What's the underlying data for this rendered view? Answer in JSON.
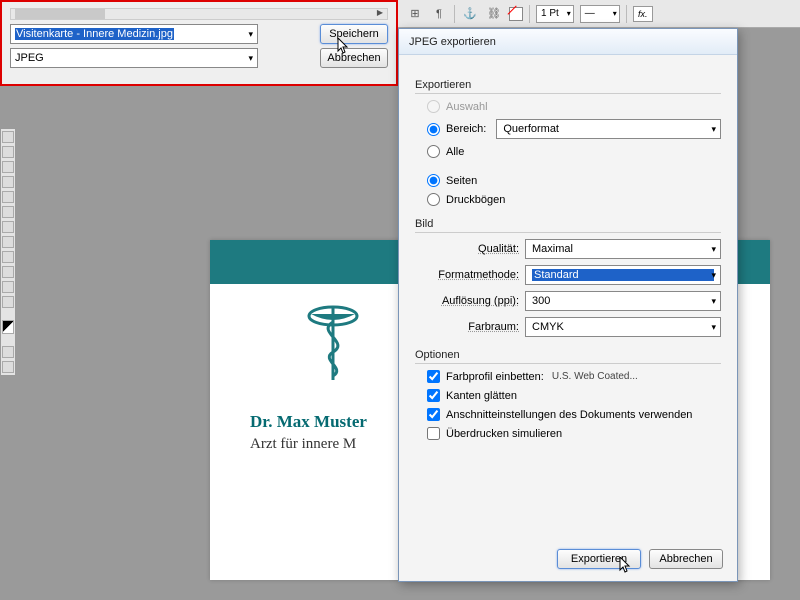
{
  "toolbar": {
    "stroke": "1 Pt",
    "fx": "fx."
  },
  "savepanel": {
    "filename": "Visitenkarte - Innere Medizin.jpg",
    "format": "JPEG",
    "save": "Speichern",
    "cancel": "Abbrechen"
  },
  "card": {
    "name": "Dr. Max Muster",
    "sub": "Arzt für innere M"
  },
  "dialog": {
    "title": "JPEG exportieren",
    "export": {
      "heading": "Exportieren",
      "auswahl": "Auswahl",
      "bereich": "Bereich:",
      "bereich_val": "Querformat",
      "alle": "Alle",
      "seiten": "Seiten",
      "druck": "Druckbögen"
    },
    "bild": {
      "heading": "Bild",
      "qual": "Qualität:",
      "qual_val": "Maximal",
      "method": "Formatmethode:",
      "method_val": "Standard",
      "res": "Auflösung (ppi):",
      "res_val": "300",
      "farb": "Farbraum:",
      "farb_val": "CMYK"
    },
    "opt": {
      "heading": "Optionen",
      "embed": "Farbprofil einbetten:",
      "profile": "U.S. Web Coated...",
      "kanten": "Kanten glätten",
      "anschnitt": "Anschnitteinstellungen des Dokuments verwenden",
      "ueber": "Überdrucken simulieren"
    },
    "buttons": {
      "export": "Exportieren",
      "cancel": "Abbrechen"
    }
  }
}
